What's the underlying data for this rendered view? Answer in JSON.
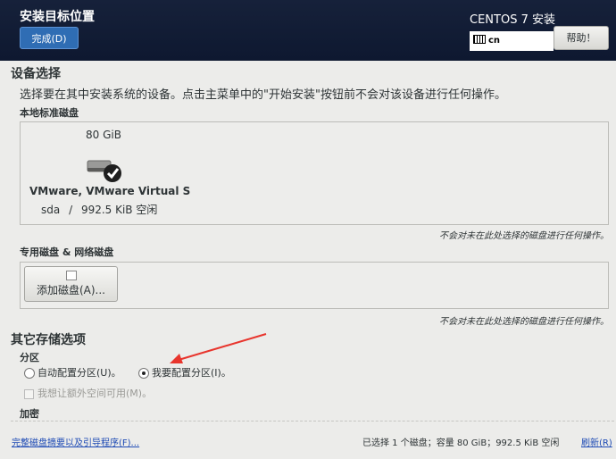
{
  "header": {
    "title": "安装目标位置",
    "done_label": "完成(D)",
    "product": "CENTOS 7 安装",
    "keyboard_layout": "cn",
    "help_label": "帮助！"
  },
  "device_selection": {
    "heading": "设备选择",
    "description": "选择要在其中安装系统的设备。点击主菜单中的\"开始安装\"按钮前不会对该设备进行任何操作。",
    "local_heading": "本地标准磁盘",
    "disk": {
      "size": "80 GiB",
      "name": "VMware, VMware Virtual S",
      "device": "sda",
      "separator": "/",
      "free": "992.5 KiB 空闲",
      "selected": true
    },
    "local_note": "不会对未在此处选择的磁盘进行任何操作。",
    "special_heading": "专用磁盘 & 网络磁盘",
    "add_disk_label": "添加磁盘(A)...",
    "special_note": "不会对未在此处选择的磁盘进行任何操作。"
  },
  "other_options": {
    "heading": "其它存储选项",
    "partition_heading": "分区",
    "auto_partition": "自动配置分区(U)。",
    "manual_partition": "我要配置分区(I)。",
    "selected_option": "manual",
    "extra_space": "我想让额外空间可用(M)。",
    "encryption_heading": "加密"
  },
  "footer": {
    "summary_link": "完整磁盘摘要以及引导程序(F)...",
    "status": "已选择 1 个磁盘；容量 80 GiB；992.5 KiB 空闲",
    "refresh_label": "刷新(R)"
  },
  "colors": {
    "header_bg": "#0e1830",
    "done_button": "#2f6db4",
    "link": "#1c49b4",
    "annotation_arrow": "#e8352d"
  }
}
